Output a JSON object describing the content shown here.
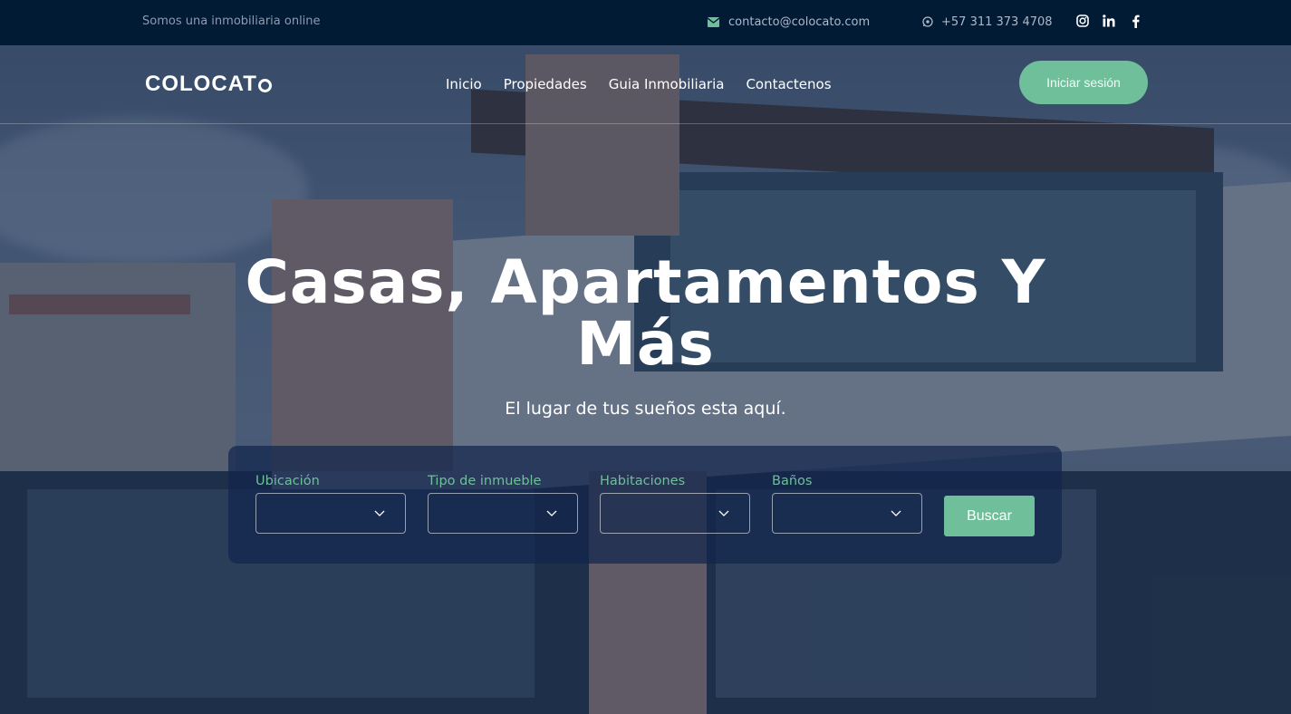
{
  "topbar": {
    "tagline": "Somos una inmobiliaria online",
    "email": "contacto@colocato.com",
    "phone": "+57 311 373 4708",
    "social_icons": [
      "instagram-icon",
      "linkedin-icon",
      "facebook-icon"
    ]
  },
  "nav": {
    "logo": "COLOCAT",
    "menu": [
      "Inicio",
      "Propiedades",
      "Guia Inmobiliaria",
      "Contactenos"
    ],
    "login_label": "Iniciar sesión"
  },
  "hero": {
    "title_line1": "Casas, Apartamentos Y",
    "title_line2": "Más",
    "subtitle": "El lugar de tus sueños esta aquí."
  },
  "search": {
    "fields": [
      {
        "label": "Ubicación",
        "value": ""
      },
      {
        "label": "Tipo de inmueble",
        "value": ""
      },
      {
        "label": "Habitaciones",
        "value": ""
      },
      {
        "label": "Baños",
        "value": ""
      }
    ],
    "button_label": "Buscar"
  },
  "colors": {
    "topbar_bg": "#011b35",
    "accent_green": "#6fbf9a",
    "overlay": "#081e42"
  }
}
